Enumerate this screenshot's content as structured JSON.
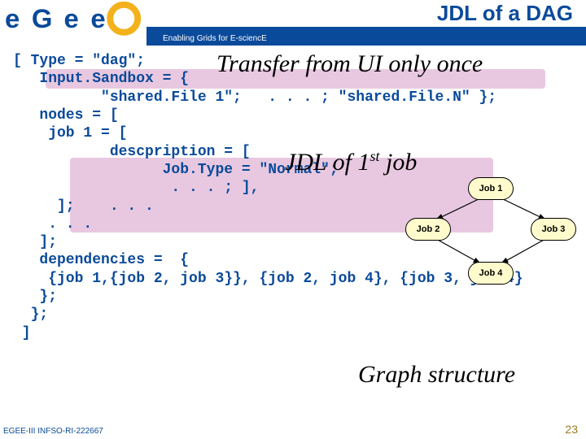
{
  "header": {
    "tagline": "Enabling Grids for E-sciencE",
    "title": "JDL of a DAG"
  },
  "callouts": {
    "transfer": "Transfer from UI only once",
    "jdl_prefix": "JDL of 1",
    "jdl_super": "st",
    "jdl_suffix": " job",
    "graph": "Graph structure"
  },
  "code": {
    "l1": "[ Type = \"dag\";",
    "l2": "   Input.Sandbox = {",
    "l3": "          \"shared.File 1\";   . . . ; \"shared.File.N\" };",
    "l4": "   nodes = [",
    "l5": "    job 1 = [",
    "l6": "           descpription = [",
    "l7": "                 Job.Type = \"Normal\";",
    "l8": "                  . . . ; ],",
    "l9": "     ];    . . .",
    "l10": "    . . .",
    "l11": "   ];",
    "l12": "   dependencies =  {",
    "l13": "    {job 1,{job 2, job 3}}, {job 2, job 4}, {job 3, job 4}",
    "l14": "   };",
    "l15": "  };",
    "l16": " ]"
  },
  "graph": {
    "n1": "Job 1",
    "n2": "Job 2",
    "n3": "Job 3",
    "n4": "Job 4"
  },
  "footer": {
    "left": "EGEE-III INFSO-RI-222667",
    "page": "23"
  }
}
